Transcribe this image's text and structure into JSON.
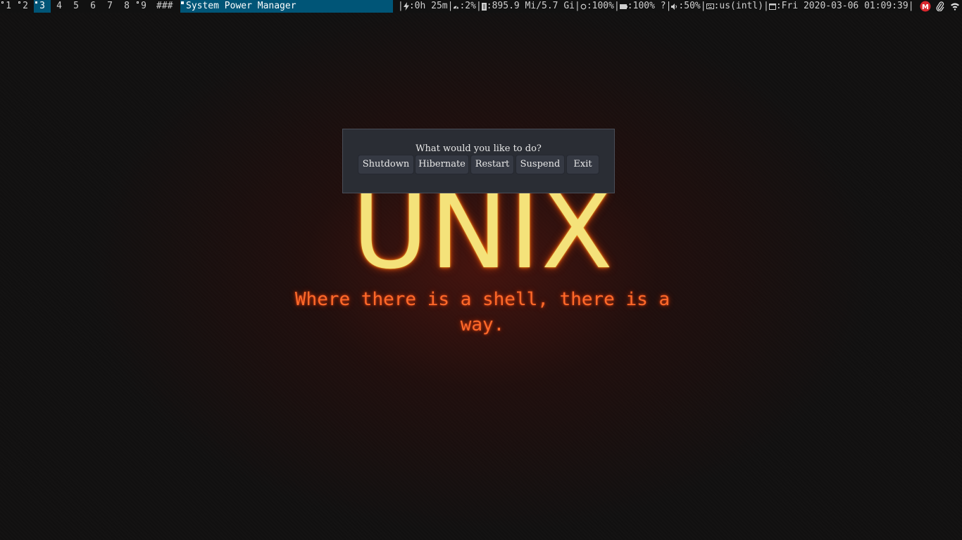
{
  "topbar": {
    "workspaces": [
      "1",
      "2",
      "3",
      "4",
      "5",
      "6",
      "7",
      "8",
      "9"
    ],
    "active_workspace": "3",
    "layout_symbol": "###",
    "window_title": "System Power Manager",
    "status": {
      "battery_time": "0h 25m",
      "cpu": "2%",
      "memory": "895.9 Mi/5.7 Gi",
      "brightness": "100%",
      "battery": "100% ?",
      "volume": "50%",
      "keyboard_layout": "us(intl)",
      "datetime": "Fri 2020-03-06 01:09:39"
    },
    "tray_icons": [
      "mega-icon",
      "paperclip-icon",
      "network-icon"
    ],
    "tray_mega_letter": "M"
  },
  "wallpaper": {
    "title": "UNIX",
    "motto": "Where there is a shell, there is a way."
  },
  "dialog": {
    "prompt": "What would you like to do?",
    "buttons": {
      "shutdown": "Shutdown",
      "hibernate": "Hibernate",
      "restart": "Restart",
      "suspend": "Suspend",
      "exit": "Exit"
    }
  },
  "colors": {
    "bar_bg": "#111111",
    "accent": "#005577",
    "unix_yellow": "#f4e27a",
    "motto_orange": "#ff6a2a",
    "dialog_bg": "#2a2d34",
    "button_bg": "#353943",
    "mega_red": "#d9272e"
  }
}
